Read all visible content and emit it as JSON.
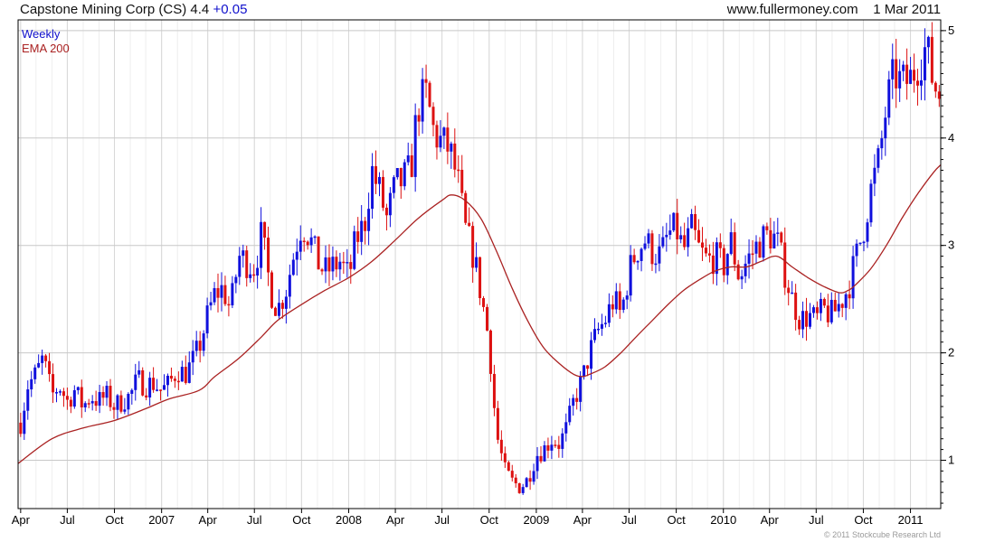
{
  "header": {
    "title": "Capstone Mining Corp (CS)",
    "price": "4.4",
    "change": "+0.05",
    "site": "www.fullermoney.com",
    "date": "1 Mar 2011"
  },
  "legend": [
    {
      "label": "Weekly",
      "color": "#1010cc"
    },
    {
      "label": "EMA 200",
      "color": "#aa2222"
    }
  ],
  "copyright": "© 2011 Stockcube Research Ltd",
  "colors": {
    "up": "#1010dd",
    "down": "#dd1111",
    "ema": "#aa2222",
    "grid": "#d8d8d8",
    "axis": "#000000"
  },
  "chart_data": {
    "type": "line",
    "title": "Capstone Mining Corp (CS)",
    "xlabel": "",
    "ylabel": "",
    "ylim": [
      0.55,
      5.1
    ],
    "y_ticks": [
      1,
      2,
      3,
      4,
      5
    ],
    "x_range": [
      "2006-03-27",
      "2011-03-01"
    ],
    "x_ticks": [
      {
        "label": "Apr",
        "date": "2006-04-01"
      },
      {
        "label": "Jul",
        "date": "2006-07-01"
      },
      {
        "label": "Oct",
        "date": "2006-10-01"
      },
      {
        "label": "2007",
        "date": "2007-01-01"
      },
      {
        "label": "Apr",
        "date": "2007-04-01"
      },
      {
        "label": "Jul",
        "date": "2007-07-01"
      },
      {
        "label": "Oct",
        "date": "2007-10-01"
      },
      {
        "label": "2008",
        "date": "2008-01-01"
      },
      {
        "label": "Apr",
        "date": "2008-04-01"
      },
      {
        "label": "Jul",
        "date": "2008-07-01"
      },
      {
        "label": "Oct",
        "date": "2008-10-01"
      },
      {
        "label": "2009",
        "date": "2009-01-01"
      },
      {
        "label": "Apr",
        "date": "2009-04-01"
      },
      {
        "label": "Jul",
        "date": "2009-07-01"
      },
      {
        "label": "Oct",
        "date": "2009-10-01"
      },
      {
        "label": "2010",
        "date": "2010-01-01"
      },
      {
        "label": "Apr",
        "date": "2010-04-01"
      },
      {
        "label": "Jul",
        "date": "2010-07-01"
      },
      {
        "label": "Oct",
        "date": "2010-10-01"
      },
      {
        "label": "2011",
        "date": "2011-01-01"
      }
    ],
    "series": [
      {
        "name": "Weekly",
        "kind": "weekly_bars",
        "points": [
          [
            "2006-04-01",
            1.35
          ],
          [
            "2006-04-15",
            1.7
          ],
          [
            "2006-05-01",
            1.8
          ],
          [
            "2006-05-15",
            1.95
          ],
          [
            "2006-06-01",
            1.6
          ],
          [
            "2006-06-15",
            1.7
          ],
          [
            "2006-07-01",
            1.55
          ],
          [
            "2006-07-15",
            1.65
          ],
          [
            "2006-08-01",
            1.5
          ],
          [
            "2006-08-15",
            1.6
          ],
          [
            "2006-09-01",
            1.55
          ],
          [
            "2006-09-15",
            1.6
          ],
          [
            "2006-10-01",
            1.5
          ],
          [
            "2006-10-15",
            1.55
          ],
          [
            "2006-11-01",
            1.6
          ],
          [
            "2006-11-15",
            1.75
          ],
          [
            "2006-12-01",
            1.7
          ],
          [
            "2006-12-15",
            1.72
          ],
          [
            "2007-01-01",
            1.65
          ],
          [
            "2007-01-15",
            1.7
          ],
          [
            "2007-02-01",
            1.85
          ],
          [
            "2007-02-15",
            1.8
          ],
          [
            "2007-03-01",
            1.9
          ],
          [
            "2007-03-15",
            2.05
          ],
          [
            "2007-04-01",
            2.35
          ],
          [
            "2007-04-15",
            2.55
          ],
          [
            "2007-05-01",
            2.6
          ],
          [
            "2007-05-15",
            2.4
          ],
          [
            "2007-06-01",
            2.9
          ],
          [
            "2007-06-15",
            2.85
          ],
          [
            "2007-07-01",
            2.8
          ],
          [
            "2007-07-15",
            3.1
          ],
          [
            "2007-08-01",
            2.6
          ],
          [
            "2007-08-15",
            2.4
          ],
          [
            "2007-09-01",
            2.6
          ],
          [
            "2007-09-15",
            2.9
          ],
          [
            "2007-10-01",
            3.2
          ],
          [
            "2007-10-15",
            3.1
          ],
          [
            "2007-11-01",
            2.85
          ],
          [
            "2007-11-15",
            2.75
          ],
          [
            "2007-12-01",
            2.8
          ],
          [
            "2007-12-15",
            2.85
          ],
          [
            "2008-01-01",
            2.7
          ],
          [
            "2008-01-15",
            3.05
          ],
          [
            "2008-02-01",
            3.2
          ],
          [
            "2008-02-15",
            3.7
          ],
          [
            "2008-03-01",
            3.5
          ],
          [
            "2008-03-15",
            3.25
          ],
          [
            "2008-04-01",
            3.55
          ],
          [
            "2008-04-15",
            3.6
          ],
          [
            "2008-05-01",
            3.7
          ],
          [
            "2008-05-15",
            4.3
          ],
          [
            "2008-06-01",
            4.4
          ],
          [
            "2008-06-15",
            4.05
          ],
          [
            "2008-07-01",
            3.95
          ],
          [
            "2008-07-15",
            3.9
          ],
          [
            "2008-08-01",
            3.6
          ],
          [
            "2008-08-15",
            3.15
          ],
          [
            "2008-09-01",
            2.9
          ],
          [
            "2008-09-15",
            2.55
          ],
          [
            "2008-10-01",
            2.1
          ],
          [
            "2008-10-15",
            1.25
          ],
          [
            "2008-11-01",
            0.9
          ],
          [
            "2008-11-15",
            0.8
          ],
          [
            "2008-12-01",
            0.75
          ],
          [
            "2008-12-15",
            0.82
          ],
          [
            "2009-01-01",
            1.05
          ],
          [
            "2009-01-15",
            1.1
          ],
          [
            "2009-02-01",
            1.2
          ],
          [
            "2009-02-15",
            1.15
          ],
          [
            "2009-03-01",
            1.3
          ],
          [
            "2009-03-15",
            1.55
          ],
          [
            "2009-04-01",
            1.75
          ],
          [
            "2009-04-15",
            2.0
          ],
          [
            "2009-05-01",
            2.2
          ],
          [
            "2009-05-15",
            2.3
          ],
          [
            "2009-06-01",
            2.5
          ],
          [
            "2009-06-15",
            2.35
          ],
          [
            "2009-07-01",
            2.75
          ],
          [
            "2009-07-15",
            2.95
          ],
          [
            "2009-08-01",
            3.05
          ],
          [
            "2009-08-15",
            2.95
          ],
          [
            "2009-09-01",
            2.9
          ],
          [
            "2009-09-15",
            3.1
          ],
          [
            "2009-10-01",
            3.15
          ],
          [
            "2009-10-15",
            2.95
          ],
          [
            "2009-11-01",
            3.15
          ],
          [
            "2009-11-15",
            2.95
          ],
          [
            "2009-12-01",
            2.85
          ],
          [
            "2009-12-15",
            2.9
          ],
          [
            "2010-01-01",
            2.8
          ],
          [
            "2010-01-15",
            3.05
          ],
          [
            "2010-02-01",
            2.7
          ],
          [
            "2010-02-15",
            2.85
          ],
          [
            "2010-03-01",
            2.95
          ],
          [
            "2010-03-15",
            3.05
          ],
          [
            "2010-04-01",
            3.1
          ],
          [
            "2010-04-15",
            3.05
          ],
          [
            "2010-05-01",
            2.75
          ],
          [
            "2010-05-15",
            2.5
          ],
          [
            "2010-06-01",
            2.3
          ],
          [
            "2010-06-15",
            2.35
          ],
          [
            "2010-07-01",
            2.3
          ],
          [
            "2010-07-15",
            2.4
          ],
          [
            "2010-08-01",
            2.35
          ],
          [
            "2010-08-15",
            2.45
          ],
          [
            "2010-09-01",
            2.6
          ],
          [
            "2010-09-15",
            2.85
          ],
          [
            "2010-10-01",
            3.15
          ],
          [
            "2010-10-15",
            3.5
          ],
          [
            "2010-11-01",
            3.8
          ],
          [
            "2010-11-15",
            4.3
          ],
          [
            "2010-12-01",
            4.6
          ],
          [
            "2010-12-15",
            4.5
          ],
          [
            "2011-01-01",
            4.55
          ],
          [
            "2011-01-15",
            4.7
          ],
          [
            "2011-02-01",
            4.85
          ],
          [
            "2011-02-15",
            4.5
          ],
          [
            "2011-03-01",
            4.4
          ]
        ]
      },
      {
        "name": "EMA 200",
        "kind": "line",
        "points": [
          [
            "2006-03-27",
            0.97
          ],
          [
            "2006-06-01",
            1.2
          ],
          [
            "2006-08-01",
            1.3
          ],
          [
            "2006-10-01",
            1.37
          ],
          [
            "2006-12-01",
            1.48
          ],
          [
            "2007-01-15",
            1.57
          ],
          [
            "2007-03-15",
            1.65
          ],
          [
            "2007-04-15",
            1.78
          ],
          [
            "2007-06-01",
            1.95
          ],
          [
            "2007-07-15",
            2.15
          ],
          [
            "2007-08-15",
            2.3
          ],
          [
            "2007-10-01",
            2.45
          ],
          [
            "2007-11-15",
            2.58
          ],
          [
            "2008-01-01",
            2.7
          ],
          [
            "2008-02-15",
            2.85
          ],
          [
            "2008-04-01",
            3.05
          ],
          [
            "2008-05-15",
            3.25
          ],
          [
            "2008-07-01",
            3.42
          ],
          [
            "2008-07-20",
            3.47
          ],
          [
            "2008-08-15",
            3.42
          ],
          [
            "2008-09-15",
            3.25
          ],
          [
            "2008-10-15",
            2.95
          ],
          [
            "2008-11-15",
            2.6
          ],
          [
            "2008-12-15",
            2.3
          ],
          [
            "2009-01-15",
            2.05
          ],
          [
            "2009-02-15",
            1.9
          ],
          [
            "2009-03-15",
            1.8
          ],
          [
            "2009-04-01",
            1.78
          ],
          [
            "2009-04-15",
            1.8
          ],
          [
            "2009-05-15",
            1.87
          ],
          [
            "2009-06-15",
            2.0
          ],
          [
            "2009-07-15",
            2.15
          ],
          [
            "2009-08-15",
            2.3
          ],
          [
            "2009-09-15",
            2.45
          ],
          [
            "2009-10-15",
            2.58
          ],
          [
            "2009-11-15",
            2.68
          ],
          [
            "2009-12-15",
            2.76
          ],
          [
            "2010-01-15",
            2.8
          ],
          [
            "2010-02-15",
            2.8
          ],
          [
            "2010-03-15",
            2.85
          ],
          [
            "2010-04-15",
            2.9
          ],
          [
            "2010-05-15",
            2.8
          ],
          [
            "2010-06-15",
            2.7
          ],
          [
            "2010-07-15",
            2.62
          ],
          [
            "2010-08-15",
            2.56
          ],
          [
            "2010-09-01",
            2.58
          ],
          [
            "2010-09-15",
            2.63
          ],
          [
            "2010-10-15",
            2.78
          ],
          [
            "2010-11-15",
            3.0
          ],
          [
            "2010-12-15",
            3.25
          ],
          [
            "2011-01-15",
            3.48
          ],
          [
            "2011-02-15",
            3.68
          ],
          [
            "2011-03-01",
            3.75
          ]
        ]
      }
    ]
  }
}
